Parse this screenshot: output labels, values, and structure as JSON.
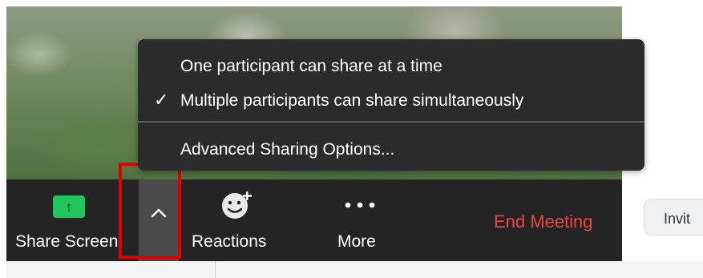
{
  "menu": {
    "items": [
      {
        "label": "One participant can share at a time",
        "checked": false
      },
      {
        "label": "Multiple participants can share simultaneously",
        "checked": true
      },
      {
        "label": "Advanced Sharing Options...",
        "checked": false
      }
    ],
    "check_glyph": "✓"
  },
  "toolbar": {
    "share_screen": {
      "label": "Share Screen",
      "icon": "↑"
    },
    "share_options_icon": "chevron-up-icon",
    "reactions": {
      "label": "Reactions"
    },
    "more": {
      "label": "More"
    },
    "end_meeting": {
      "label": "End Meeting",
      "color": "#ef4444"
    }
  },
  "invite_button": {
    "label": "Invit"
  },
  "colors": {
    "share_green": "#22c55e",
    "toolbar_bg": "#242424",
    "highlight_box": "#e00000"
  }
}
